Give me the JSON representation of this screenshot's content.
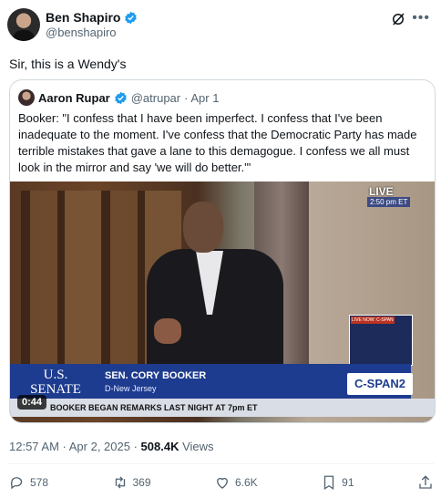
{
  "author": {
    "name": "Ben Shapiro",
    "handle": "@benshapiro"
  },
  "tweet": {
    "text": "Sir, this is a Wendy's"
  },
  "quote": {
    "name": "Aaron Rupar",
    "handle": "@atrupar",
    "date": "· Apr 1",
    "text": "Booker: \"I confess that I have been imperfect. I confess that I've been inadequate to the moment. I've confess that the Democratic Party has made terrible mistakes that gave a lane to this demagogue. I confess we all must look in the mirror and say 'we will do better.'\""
  },
  "video": {
    "live_label": "LIVE",
    "live_time": "2:50 pm ET",
    "inset_label": "LIVE NOW: C-SPAN",
    "chyron_org": "U.S. SENATE",
    "chyron_name": "SEN. CORY BOOKER",
    "chyron_sub": "D-New Jersey",
    "network": "C-SPAN2",
    "ticker": "BOOKER BEGAN REMARKS LAST NIGHT AT 7pm ET",
    "duration": "0:44"
  },
  "meta": {
    "time": "12:57 AM · Apr 2, 2025 · ",
    "views_count": "508.4K",
    "views_label": " Views"
  },
  "actions": {
    "replies": "578",
    "reposts": "369",
    "likes": "6.6K",
    "bookmarks": "91"
  },
  "colors": {
    "verified": "#1d9bf0",
    "chyron": "#1e3c8f"
  }
}
